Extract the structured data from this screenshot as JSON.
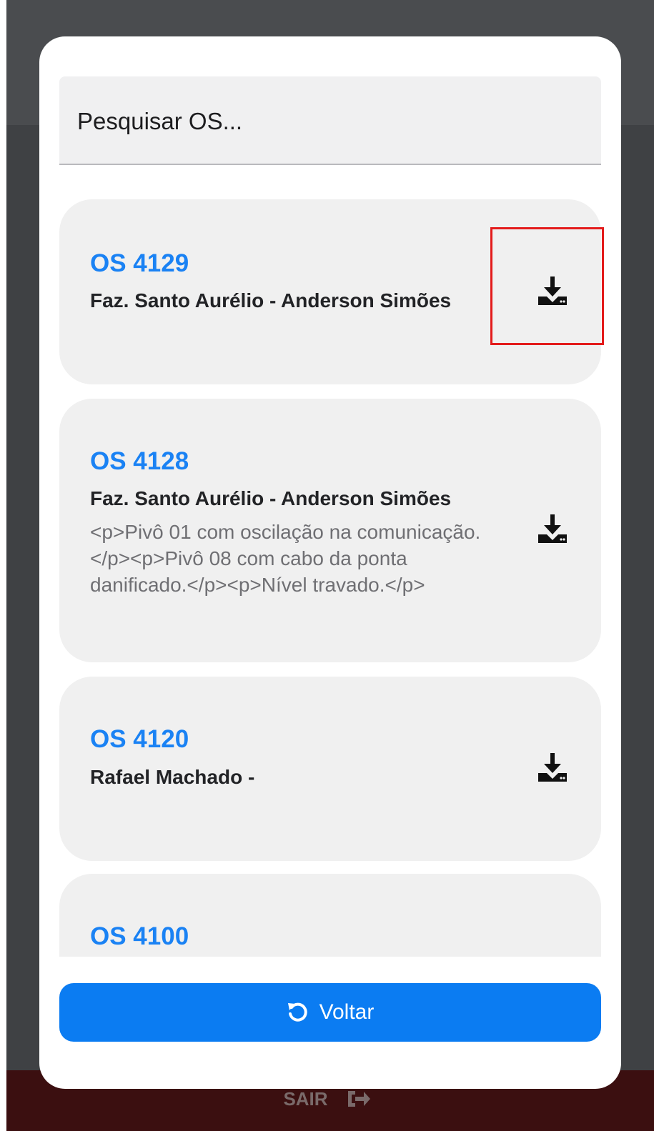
{
  "search": {
    "placeholder": "Pesquisar OS..."
  },
  "orders": [
    {
      "os": "OS 4129",
      "client": "Faz. Santo Aurélio - Anderson Simões",
      "description": ""
    },
    {
      "os": "OS 4128",
      "client": "Faz. Santo Aurélio - Anderson Simões",
      "description": "<p>Pivô 01 com oscilação na comunicação.</p><p>Pivô 08 com cabo da ponta danificado.</p><p>Nível travado.</p>"
    },
    {
      "os": "OS 4120",
      "client": "Rafael Machado -",
      "description": ""
    },
    {
      "os": "OS 4100",
      "client": "",
      "description": ""
    }
  ],
  "back_button": {
    "label": "Voltar",
    "icon": "undo-icon"
  },
  "background": {
    "footer_label": "SAIR",
    "footer_icon": "logout-icon"
  },
  "colors": {
    "accent": "#0b7cf2",
    "os_number": "#1a82f4",
    "highlight": "#e31b1b",
    "card_bg": "#f0f0f0"
  }
}
